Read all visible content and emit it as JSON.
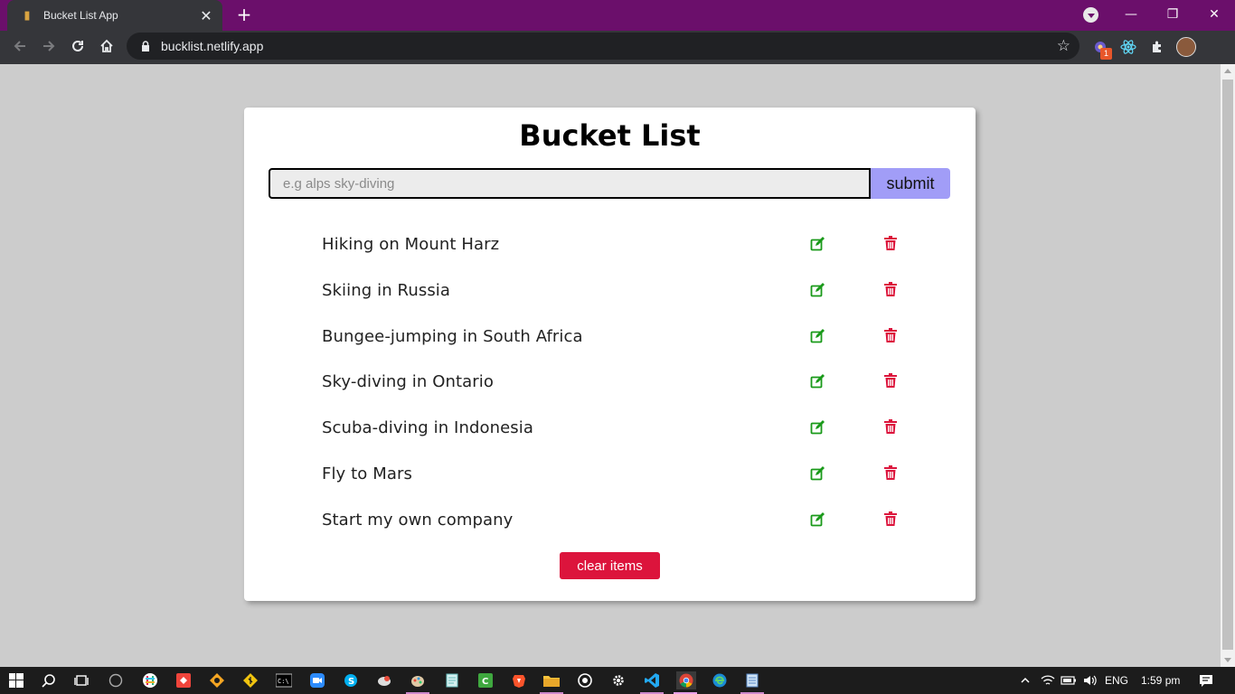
{
  "browser": {
    "tab_title": "Bucket List App",
    "tab_close": "✕",
    "new_tab": "+",
    "url": "bucklist.netlify.app",
    "extension_badge": "1",
    "window_controls": {
      "minimize": "—",
      "restore": "❐",
      "close": "✕"
    }
  },
  "app": {
    "title": "Bucket List",
    "input_placeholder": "e.g alps sky-diving",
    "input_value": "",
    "submit_label": "submit",
    "clear_label": "clear items",
    "items": [
      {
        "label": "Hiking on Mount Harz"
      },
      {
        "label": "Skiing in Russia"
      },
      {
        "label": "Bungee-jumping in South Africa"
      },
      {
        "label": "Sky-diving in Ontario"
      },
      {
        "label": "Scuba-diving in Indonesia"
      },
      {
        "label": "Fly to Mars"
      },
      {
        "label": "Start my own company"
      }
    ],
    "colors": {
      "edit": "#1a9a1a",
      "delete": "#dc143c",
      "submit_bg": "#a19df7",
      "clear_bg": "#dc143c"
    }
  },
  "taskbar": {
    "language": "ENG",
    "time": "1:59 pm"
  }
}
